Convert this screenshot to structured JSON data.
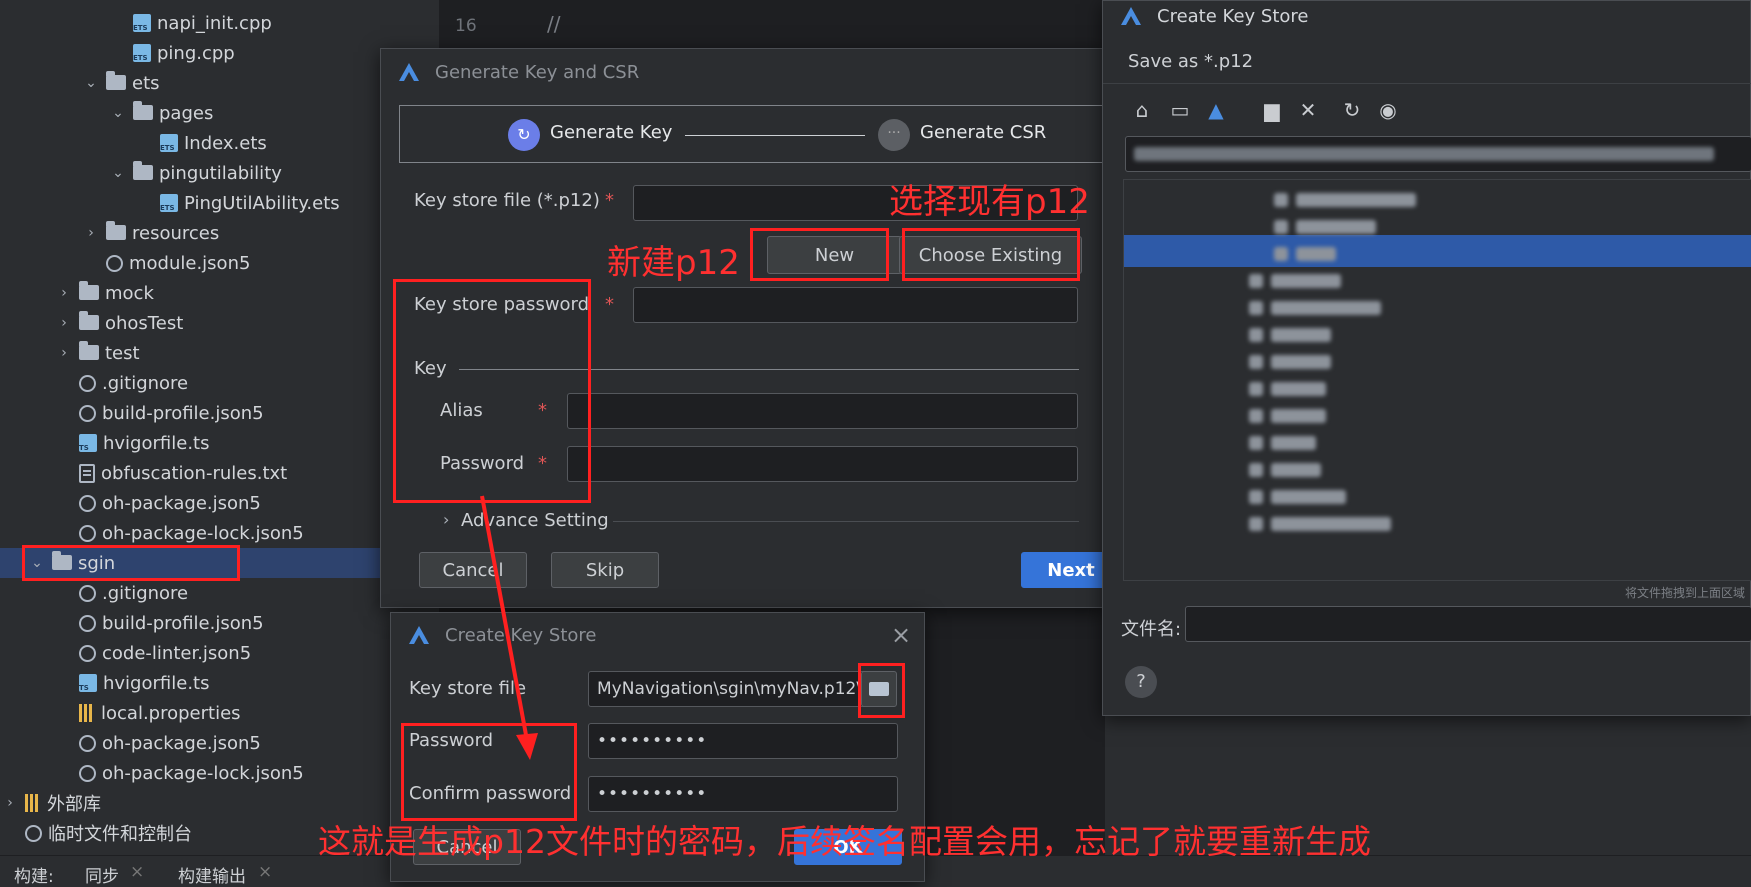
{
  "tree": {
    "items": [
      {
        "label": "napi_init.cpp",
        "indent": 3,
        "icon": "cpp-file-icon",
        "chev": ""
      },
      {
        "label": "ping.cpp",
        "indent": 3,
        "icon": "cpp-file-icon",
        "chev": ""
      },
      {
        "label": "ets",
        "indent": 2,
        "icon": "folder-icon",
        "chev": "v"
      },
      {
        "label": "pages",
        "indent": 3,
        "icon": "folder-icon",
        "chev": "v"
      },
      {
        "label": "Index.ets",
        "indent": 4,
        "icon": "ets-file-icon",
        "chev": ""
      },
      {
        "label": "pingutilability",
        "indent": 3,
        "icon": "folder-icon",
        "chev": "v"
      },
      {
        "label": "PingUtilAbility.ets",
        "indent": 4,
        "icon": "ets-file-icon",
        "chev": ""
      },
      {
        "label": "resources",
        "indent": 2,
        "icon": "folder-icon",
        "chev": ">"
      },
      {
        "label": "module.json5",
        "indent": 2,
        "icon": "json-file-icon",
        "chev": ""
      },
      {
        "label": "mock",
        "indent": 1,
        "icon": "folder-icon",
        "chev": ">"
      },
      {
        "label": "ohosTest",
        "indent": 1,
        "icon": "folder-icon",
        "chev": ">"
      },
      {
        "label": "test",
        "indent": 1,
        "icon": "folder-icon",
        "chev": ">"
      },
      {
        "label": ".gitignore",
        "indent": 1,
        "icon": "json-file-icon",
        "chev": ""
      },
      {
        "label": "build-profile.json5",
        "indent": 1,
        "icon": "json-file-icon",
        "chev": ""
      },
      {
        "label": "hvigorfile.ts",
        "indent": 1,
        "icon": "ts-file-icon",
        "chev": ""
      },
      {
        "label": "obfuscation-rules.txt",
        "indent": 1,
        "icon": "text-file-icon",
        "chev": ""
      },
      {
        "label": "oh-package.json5",
        "indent": 1,
        "icon": "json-file-icon",
        "chev": ""
      },
      {
        "label": "oh-package-lock.json5",
        "indent": 1,
        "icon": "json-file-icon",
        "chev": ""
      },
      {
        "label": "sgin",
        "indent": 0,
        "icon": "folder-icon",
        "chev": "v"
      },
      {
        "label": ".gitignore",
        "indent": 1,
        "icon": "json-file-icon",
        "chev": ""
      },
      {
        "label": "build-profile.json5",
        "indent": 1,
        "icon": "json-file-icon",
        "chev": ""
      },
      {
        "label": "code-linter.json5",
        "indent": 1,
        "icon": "json-file-icon",
        "chev": ""
      },
      {
        "label": "hvigorfile.ts",
        "indent": 1,
        "icon": "ts-file-icon",
        "chev": ""
      },
      {
        "label": "local.properties",
        "indent": 1,
        "icon": "properties-file-icon",
        "chev": ""
      },
      {
        "label": "oh-package.json5",
        "indent": 1,
        "icon": "json-file-icon",
        "chev": ""
      },
      {
        "label": "oh-package-lock.json5",
        "indent": 1,
        "icon": "json-file-icon",
        "chev": ""
      },
      {
        "label": "外部库",
        "indent": -1,
        "icon": "library-icon",
        "chev": ">"
      },
      {
        "label": "临时文件和控制台",
        "indent": -1,
        "icon": "scratch-icon",
        "chev": ""
      }
    ]
  },
  "editor": {
    "line_number": "16",
    "line_text": "//"
  },
  "statusbar": {
    "build": "构建:",
    "sync": "同步",
    "build_output": "构建输出",
    "close": "×"
  },
  "gen_dialog": {
    "title": "Generate Key and CSR",
    "step1": "Generate Key",
    "step2": "Generate CSR",
    "keystore_label": "Key store file (*.p12)",
    "new_btn": "New",
    "choose_btn": "Choose Existing",
    "password_label": "Key store password",
    "key_section": "Key",
    "alias_label": "Alias",
    "key_password_label": "Password",
    "advance": "Advance Setting",
    "cancel": "Cancel",
    "skip": "Skip",
    "next": "Next",
    "req": "*"
  },
  "create_dialog": {
    "title": "Create Key Store",
    "keystore_label": "Key store file",
    "keystore_value": "\\MyNavigation\\sgin\\myNav.p12",
    "password_label": "Password",
    "password_value": "••••••••••",
    "confirm_label": "Confirm password",
    "confirm_value": "••••••••••",
    "cancel": "Cancel",
    "ok": "OK"
  },
  "file_chooser": {
    "title": "Create Key Store",
    "subtitle": "Save as *.p12",
    "hint": "将文件拖拽到上面区域",
    "filename_label": "文件名:",
    "help": "?"
  },
  "annotations": {
    "choose_existing": "选择现有p12",
    "new_p12": "新建p12",
    "password_note": "这就是生成p12文件时的密码，后续签名配置会用，忘记了就要重新生成"
  }
}
